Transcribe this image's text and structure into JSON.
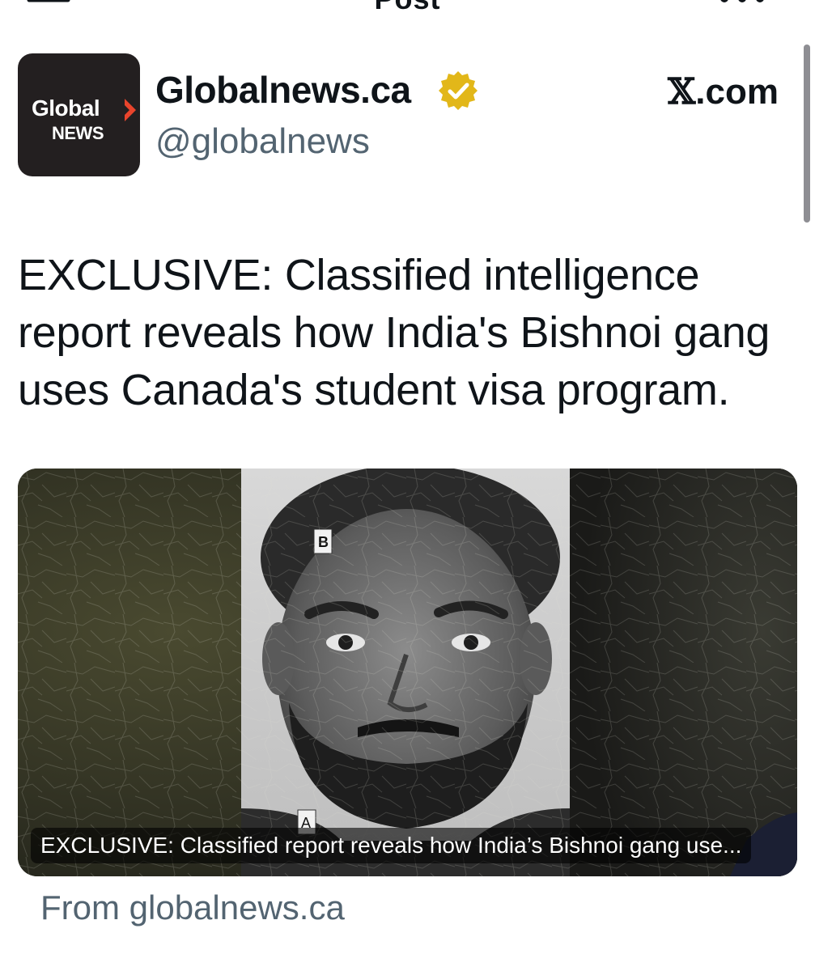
{
  "nav": {
    "title": "Post",
    "back_icon": "arrow-left-icon",
    "more_icon": "more-horizontal-icon"
  },
  "author": {
    "display_name": "Globalnews.ca",
    "handle": "@globalnews",
    "verified_badge_icon": "verified-gold-badge-icon",
    "verified_badge_color": "#e2b719",
    "avatar": {
      "logo_line1": "Global",
      "logo_line2": "NEWS",
      "logo_bg_color": "#231f20",
      "logo_accent_color": "#e8442c"
    }
  },
  "source_brand": {
    "x_glyph": "𝕏",
    "suffix": ".com"
  },
  "post": {
    "text": "EXCLUSIVE: Classified intelligence report reveals how India's Bishnoi gang uses Canada's student visa program."
  },
  "card": {
    "caption": "EXCLUSIVE: Classified report reveals how India’s Bishnoi gang use...",
    "image_label_b": "B",
    "image_label_a": "A",
    "from_text": "From globalnews.ca"
  },
  "colors": {
    "text_primary": "#0f1419",
    "text_secondary": "#536471"
  }
}
